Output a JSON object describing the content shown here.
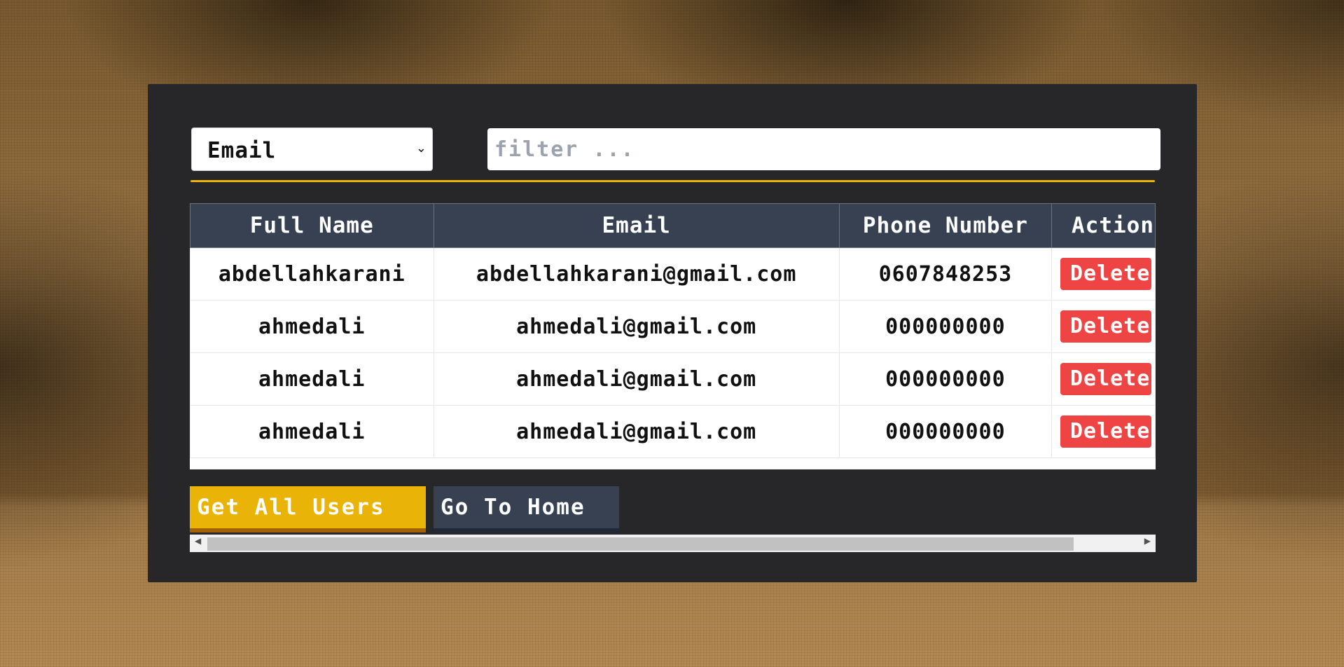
{
  "filter": {
    "field_select_value": "Email",
    "input_placeholder": "filter ...",
    "input_value": ""
  },
  "table": {
    "headers": [
      "Full Name",
      "Email",
      "Phone Number",
      "Action"
    ],
    "rows": [
      {
        "full_name": "abdellahkarani",
        "email": "abdellahkarani@gmail.com",
        "phone": "0607848253",
        "action_label": "Delete"
      },
      {
        "full_name": "ahmedali",
        "email": "ahmedali@gmail.com",
        "phone": "000000000",
        "action_label": "Delete"
      },
      {
        "full_name": "ahmedali",
        "email": "ahmedali@gmail.com",
        "phone": "000000000",
        "action_label": "Delete"
      },
      {
        "full_name": "ahmedali",
        "email": "ahmedali@gmail.com",
        "phone": "000000000",
        "action_label": "Delete"
      }
    ]
  },
  "buttons": {
    "get_all_users": "Get All Users",
    "go_to_home": "Go To Home"
  },
  "colors": {
    "accent_gold": "#eab308",
    "header_slate": "#374151",
    "delete_red": "#ef4444",
    "panel_bg": "#27272a"
  },
  "icons": {
    "select_chevron": "chevron-down-icon",
    "scroll_left": "triangle-left-icon",
    "scroll_right": "triangle-right-icon"
  }
}
